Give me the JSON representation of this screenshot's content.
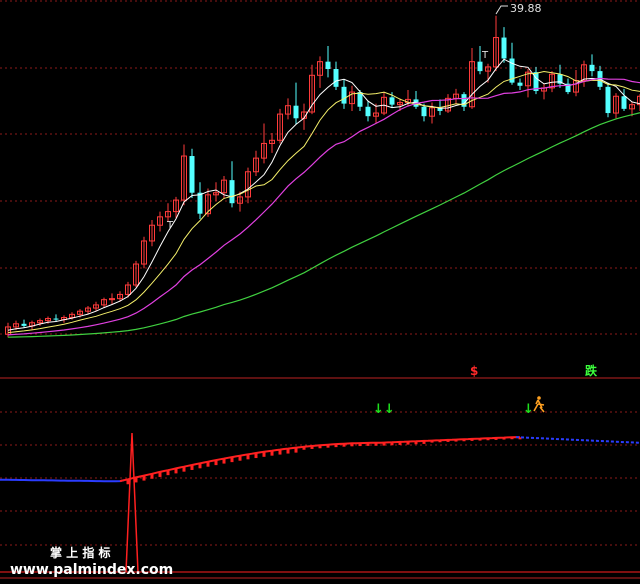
{
  "chart_data": [
    {
      "type": "candlestick",
      "panel": "price",
      "annotations": {
        "high_label": "39.88",
        "t_markers": [
          "T",
          "T"
        ],
        "signal_sell": "$",
        "signal_fall": "跌"
      },
      "colors": {
        "up": "#ff3b3b",
        "down": "#54ffff",
        "ma_white": "#ffffff",
        "ma_yellow": "#f5f06b",
        "ma_magenta": "#e040e0",
        "ma_green": "#40d040",
        "grid": "#8b1a1a"
      },
      "ohlc": [
        [
          9.5,
          10.6,
          9.2,
          10.2
        ],
        [
          10.2,
          10.8,
          9.9,
          10.5
        ],
        [
          10.5,
          10.9,
          10.1,
          10.3
        ],
        [
          10.3,
          10.8,
          9.9,
          10.6
        ],
        [
          10.6,
          11.0,
          10.3,
          10.8
        ],
        [
          10.8,
          11.2,
          10.5,
          11.0
        ],
        [
          11.0,
          11.4,
          10.7,
          10.9
        ],
        [
          10.9,
          11.3,
          10.6,
          11.1
        ],
        [
          11.1,
          11.6,
          10.9,
          11.4
        ],
        [
          11.4,
          11.9,
          11.1,
          11.7
        ],
        [
          11.7,
          12.2,
          11.4,
          12.0
        ],
        [
          12.0,
          12.6,
          11.7,
          12.3
        ],
        [
          12.3,
          13.0,
          12.0,
          12.8
        ],
        [
          12.8,
          13.4,
          12.4,
          12.9
        ],
        [
          12.9,
          13.6,
          12.6,
          13.3
        ],
        [
          13.3,
          14.5,
          13.0,
          14.2
        ],
        [
          14.2,
          16.5,
          14.0,
          16.2
        ],
        [
          16.2,
          18.8,
          15.8,
          18.4
        ],
        [
          18.4,
          20.4,
          17.9,
          19.9
        ],
        [
          19.9,
          21.2,
          19.3,
          20.7
        ],
        [
          20.7,
          22.0,
          20.2,
          21.2
        ],
        [
          21.2,
          22.6,
          20.6,
          22.3
        ],
        [
          22.3,
          27.6,
          21.8,
          26.5
        ],
        [
          26.5,
          27.2,
          22.5,
          23.0
        ],
        [
          23.0,
          24.0,
          20.5,
          21.0
        ],
        [
          21.0,
          23.4,
          20.7,
          22.8
        ],
        [
          22.8,
          24.0,
          22.2,
          23.0
        ],
        [
          23.0,
          24.6,
          22.5,
          24.2
        ],
        [
          24.2,
          26.0,
          21.6,
          22.0
        ],
        [
          22.0,
          23.1,
          21.2,
          22.6
        ],
        [
          22.6,
          25.4,
          22.0,
          25.0
        ],
        [
          25.0,
          27.0,
          24.6,
          26.3
        ],
        [
          26.3,
          29.6,
          25.8,
          27.7
        ],
        [
          27.7,
          28.7,
          26.8,
          28.0
        ],
        [
          28.0,
          31.0,
          27.7,
          30.5
        ],
        [
          30.5,
          32.0,
          30.0,
          31.3
        ],
        [
          31.3,
          33.5,
          29.5,
          30.1
        ],
        [
          30.1,
          31.5,
          29.0,
          30.7
        ],
        [
          30.7,
          35.2,
          30.5,
          34.2
        ],
        [
          34.2,
          36.0,
          33.0,
          35.5
        ],
        [
          35.5,
          37.0,
          34.0,
          34.8
        ],
        [
          34.8,
          35.5,
          32.8,
          33.1
        ],
        [
          33.1,
          33.8,
          31.0,
          31.5
        ],
        [
          31.5,
          33.2,
          30.8,
          32.6
        ],
        [
          32.6,
          32.8,
          30.8,
          31.2
        ],
        [
          31.2,
          31.8,
          29.8,
          30.3
        ],
        [
          30.3,
          31.5,
          29.6,
          30.6
        ],
        [
          30.6,
          32.6,
          30.4,
          32.1
        ],
        [
          32.1,
          32.6,
          31.1,
          31.4
        ],
        [
          31.4,
          32.0,
          30.8,
          31.6
        ],
        [
          31.6,
          32.8,
          31.3,
          31.9
        ],
        [
          31.9,
          32.7,
          31.0,
          31.2
        ],
        [
          31.2,
          31.5,
          29.8,
          30.3
        ],
        [
          30.3,
          31.6,
          29.6,
          31.1
        ],
        [
          31.1,
          31.9,
          30.4,
          30.8
        ],
        [
          30.8,
          32.4,
          30.6,
          32.0
        ],
        [
          32.0,
          32.9,
          31.4,
          32.4
        ],
        [
          32.4,
          32.6,
          30.8,
          31.2
        ],
        [
          31.2,
          36.8,
          31.0,
          35.5
        ],
        [
          35.5,
          37.0,
          34.3,
          34.6
        ],
        [
          34.6,
          35.3,
          33.5,
          35.0
        ],
        [
          35.0,
          39.88,
          34.6,
          37.8
        ],
        [
          37.8,
          38.8,
          35.4,
          35.8
        ],
        [
          35.8,
          37.3,
          33.3,
          33.5
        ],
        [
          33.5,
          33.9,
          32.8,
          33.2
        ],
        [
          33.2,
          34.8,
          32.1,
          34.5
        ],
        [
          34.5,
          35.0,
          32.4,
          32.7
        ],
        [
          32.7,
          33.4,
          31.9,
          33.0
        ],
        [
          33.0,
          34.6,
          32.6,
          34.3
        ],
        [
          34.3,
          35.2,
          33.0,
          33.4
        ],
        [
          33.4,
          33.9,
          32.4,
          32.6
        ],
        [
          32.6,
          34.7,
          32.2,
          33.7
        ],
        [
          33.7,
          35.6,
          33.1,
          35.2
        ],
        [
          35.2,
          36.2,
          34.1,
          34.6
        ],
        [
          34.6,
          35.1,
          32.8,
          33.1
        ],
        [
          33.1,
          33.5,
          30.2,
          30.6
        ],
        [
          30.6,
          32.5,
          30.1,
          32.2
        ],
        [
          32.2,
          32.9,
          30.8,
          31.0
        ],
        [
          31.0,
          31.7,
          30.3,
          31.4
        ],
        [
          31.4,
          32.4,
          30.8,
          32.2
        ]
      ],
      "ylim": [
        8,
        41
      ]
    },
    {
      "type": "line",
      "panel": "indicator",
      "signals": {
        "arrows": [
          "↓↓",
          "↓"
        ]
      },
      "spike": {
        "index": 29,
        "value": 100
      },
      "baseline": 38,
      "ylim": [
        0,
        100
      ]
    }
  ],
  "watermark": {
    "line1": "掌 上 指 标",
    "line2": "www.palmindex.com"
  }
}
